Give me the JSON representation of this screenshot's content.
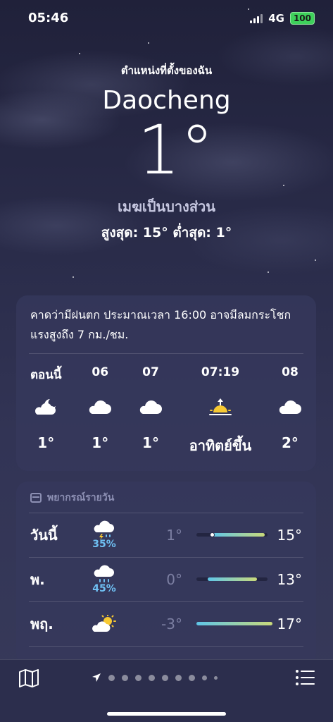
{
  "status": {
    "time": "05:46",
    "network": "4G",
    "battery": "100"
  },
  "header": {
    "location_label": "ตำแหน่งที่ตั้งของฉัน",
    "city": "Daocheng",
    "temperature": "1°",
    "condition": "เมฆเป็นบางส่วน",
    "high_low": "สูงสุด: 15°  ต่ำสุด: 1°"
  },
  "hourly": {
    "summary": "คาดว่ามีฝนตก ประมาณเวลา 16:00 อาจมีลมกระโชกแรงสูงถึง 7 กม./ชม.",
    "items": [
      {
        "label": "ตอนนี้",
        "icon": "cloud-moon-icon",
        "temp": "1°"
      },
      {
        "label": "06",
        "icon": "cloud-icon",
        "temp": "1°"
      },
      {
        "label": "07",
        "icon": "cloud-icon",
        "temp": "1°"
      },
      {
        "label": "07:19",
        "icon": "sunrise-icon",
        "temp": "อาทิตย์ขึ้น"
      },
      {
        "label": "08",
        "icon": "cloud-icon",
        "temp": "2°"
      }
    ]
  },
  "daily": {
    "heading": "พยากรณ์รายวัน",
    "days": [
      {
        "name": "วันนี้",
        "icon": "cloud-bolt-rain-icon",
        "pop": "35%",
        "low": "1°",
        "high": "15°",
        "range": [
          1,
          15
        ],
        "current": 1
      },
      {
        "name": "พ.",
        "icon": "cloud-rain-icon",
        "pop": "45%",
        "low": "0°",
        "high": "13°",
        "range": [
          0,
          13
        ]
      },
      {
        "name": "พฤ.",
        "icon": "cloud-sun-icon",
        "pop": "",
        "low": "-3°",
        "high": "17°",
        "range": [
          -3,
          17
        ]
      }
    ],
    "scale": [
      -3,
      17
    ]
  },
  "colors": {
    "rain_chance": "#6fc0f3",
    "bar_cool": "#5fc6e8",
    "bar_warm": "#c9d97a"
  }
}
